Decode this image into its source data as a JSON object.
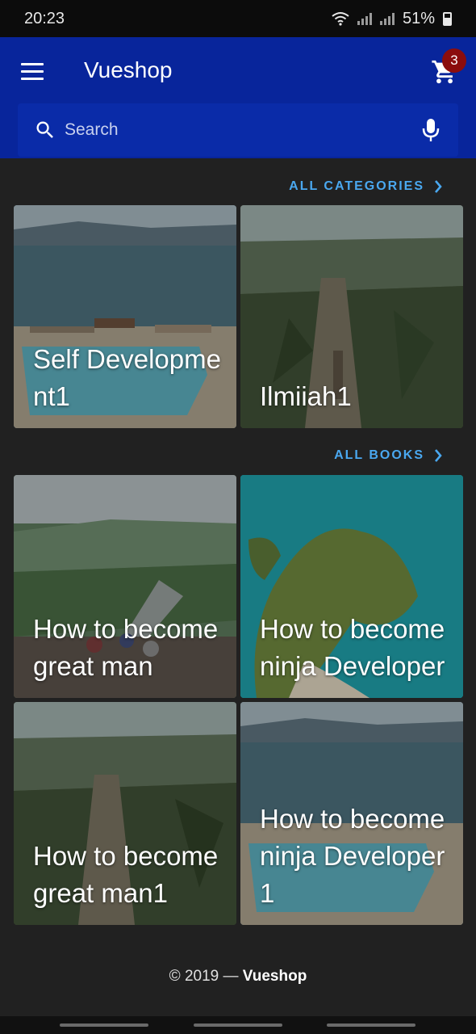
{
  "status_bar": {
    "time": "20:23",
    "battery": "51%"
  },
  "appbar": {
    "title": "Vueshop",
    "cart_count": "3"
  },
  "search": {
    "placeholder": "Search"
  },
  "categories": {
    "link_label": "ALL CATEGORIES",
    "items": [
      {
        "title": "Self Development1"
      },
      {
        "title": "Ilmiiah1"
      }
    ]
  },
  "books": {
    "link_label": "ALL BOOKS",
    "items": [
      {
        "title": "How to become great man"
      },
      {
        "title": "How to become ninja Developer"
      },
      {
        "title": "How to become great man1"
      },
      {
        "title": "How to become ninja Developer1"
      }
    ]
  },
  "footer": {
    "year": "© 2019 — ",
    "brand": "Vueshop"
  },
  "colors": {
    "appbar": "#08259b",
    "accent": "#4aa8f0",
    "badge": "#8b0d0d",
    "background": "#212121"
  }
}
